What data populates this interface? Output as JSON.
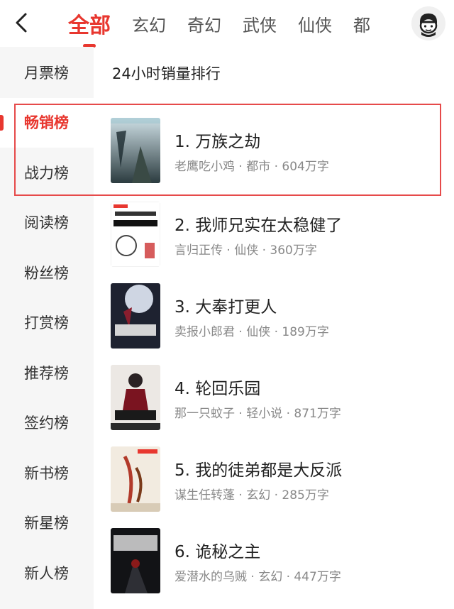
{
  "header": {
    "tabs": [
      {
        "label": "全部",
        "active": true
      },
      {
        "label": "玄幻",
        "active": false
      },
      {
        "label": "奇幻",
        "active": false
      },
      {
        "label": "武侠",
        "active": false
      },
      {
        "label": "仙侠",
        "active": false
      },
      {
        "label": "都",
        "active": false
      }
    ]
  },
  "sidebar": {
    "items": [
      {
        "label": "月票榜",
        "active": false
      },
      {
        "label": "畅销榜",
        "active": true
      },
      {
        "label": "战力榜",
        "active": false
      },
      {
        "label": "阅读榜",
        "active": false
      },
      {
        "label": "粉丝榜",
        "active": false
      },
      {
        "label": "打赏榜",
        "active": false
      },
      {
        "label": "推荐榜",
        "active": false
      },
      {
        "label": "签约榜",
        "active": false
      },
      {
        "label": "新书榜",
        "active": false
      },
      {
        "label": "新星榜",
        "active": false
      },
      {
        "label": "新人榜",
        "active": false
      }
    ]
  },
  "main": {
    "title": "24小时销量排行",
    "books": [
      {
        "title": "1. 万族之劫",
        "meta": "老鹰吃小鸡 · 都市 · 604万字"
      },
      {
        "title": "2. 我师兄实在太稳健了",
        "meta": "言归正传 · 仙侠 · 360万字"
      },
      {
        "title": "3. 大奉打更人",
        "meta": "卖报小郎君 · 仙侠 · 189万字"
      },
      {
        "title": "4. 轮回乐园",
        "meta": "那一只蚊子 · 轻小说 · 871万字"
      },
      {
        "title": "5. 我的徒弟都是大反派",
        "meta": "谋生任转蓬 · 玄幻 · 285万字"
      },
      {
        "title": "6. 诡秘之主",
        "meta": "爱潜水的乌贼 · 玄幻 · 447万字"
      }
    ]
  },
  "colors": {
    "accent": "#e8372f",
    "sidebar_bg": "#f6f6f6",
    "highlight_border": "#e64a4a"
  }
}
